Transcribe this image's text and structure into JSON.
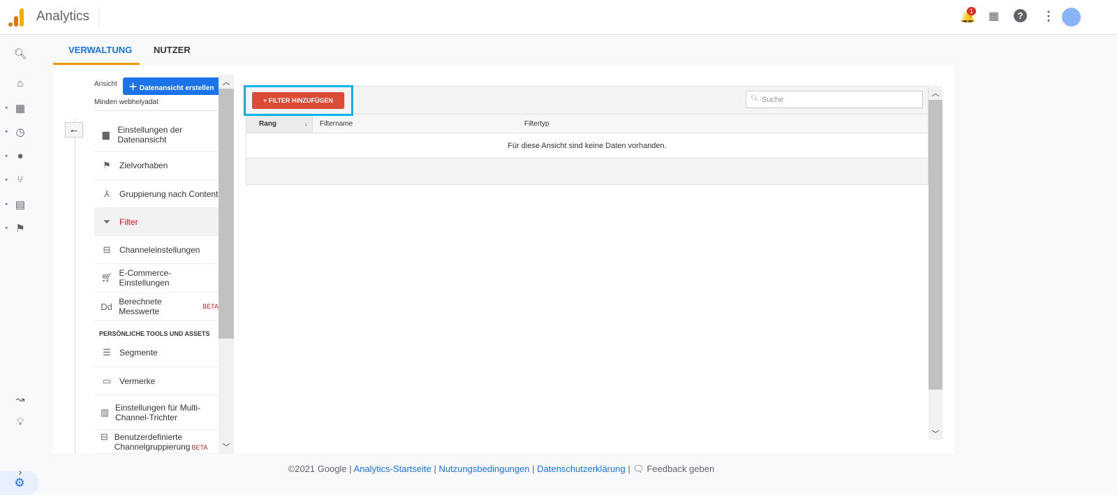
{
  "header": {
    "app_name": "Analytics",
    "notification_count": "1"
  },
  "tabs": [
    {
      "label": "VERWALTUNG"
    },
    {
      "label": "NUTZER"
    }
  ],
  "view": {
    "label": "Ansicht",
    "create_button": "Datenansicht erstellen",
    "current": "Minden webhelyadat"
  },
  "nav": {
    "items": [
      {
        "label": "Einstellungen der Datenansicht",
        "icon": "document-icon"
      },
      {
        "label": "Zielvorhaben",
        "icon": "flag-icon"
      },
      {
        "label": "Gruppierung nach Content",
        "icon": "grouping-icon"
      },
      {
        "label": "Filter",
        "icon": "filter-icon",
        "selected": true
      },
      {
        "label": "Channeleinstellungen",
        "icon": "channel-icon"
      },
      {
        "label": "E-Commerce-Einstellungen",
        "icon": "cart-icon"
      },
      {
        "label": "Berechnete Messwerte",
        "icon": "dd-icon",
        "badge": "BETA"
      }
    ],
    "section_title": "PERSÖNLICHE TOOLS UND ASSETS",
    "tools": [
      {
        "label": "Segmente",
        "icon": "segments-icon"
      },
      {
        "label": "Vermerke",
        "icon": "comment-icon"
      },
      {
        "label": "Einstellungen für Multi-Channel-Trichter",
        "icon": "bar-chart-icon"
      },
      {
        "label": "Benutzerdefinierte Channelgruppierung",
        "icon": "channel-icon",
        "badge": "BETA"
      }
    ]
  },
  "filters": {
    "add_button": "+ FILTER HINZUFÜGEN",
    "search_placeholder": "Suche",
    "columns": [
      "Rang",
      "Filtername",
      "Filtertyp"
    ],
    "empty_message": "Für diese Ansicht sind keine Daten vorhanden."
  },
  "footer": {
    "copyright": "©2021 Google |",
    "link1": "Analytics-Startseite",
    "sep1": "|",
    "link2": "Nutzungsbedingungen",
    "sep2": "|",
    "link3": "Datenschutzerklärung",
    "sep3": "|",
    "feedback": "Feedback geben"
  },
  "colors": {
    "accent": "#1a73e8",
    "add_button": "#dc4a38",
    "highlight": "#00b7eb",
    "tab_underline": "#f29900"
  }
}
